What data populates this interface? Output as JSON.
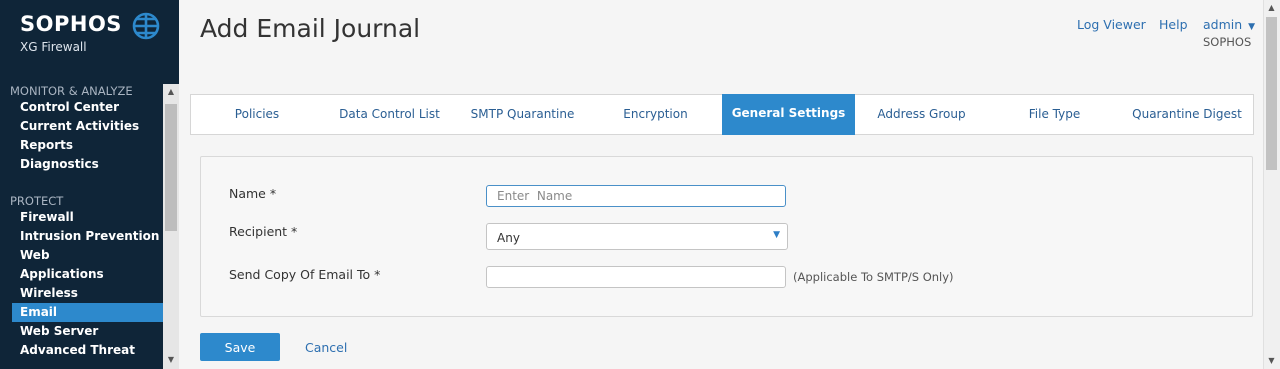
{
  "brand": {
    "name": "SOPHOS",
    "product": "XG Firewall"
  },
  "sidebar": {
    "sections": [
      {
        "title": "MONITOR & ANALYZE",
        "items": [
          "Control Center",
          "Current Activities",
          "Reports",
          "Diagnostics"
        ]
      },
      {
        "title": "PROTECT",
        "items": [
          "Firewall",
          "Intrusion Prevention",
          "Web",
          "Applications",
          "Wireless",
          "Email",
          "Web Server",
          "Advanced Threat"
        ]
      }
    ],
    "active_item": "Email"
  },
  "header": {
    "title": "Add Email Journal",
    "links": {
      "log_viewer": "Log Viewer",
      "help": "Help",
      "user": "admin"
    },
    "user_org": "SOPHOS"
  },
  "tabs": [
    "Policies",
    "Data Control List",
    "SMTP Quarantine",
    "Encryption",
    "General Settings",
    "Address Group",
    "File Type",
    "Quarantine Digest"
  ],
  "active_tab": "General Settings",
  "form": {
    "name": {
      "label": "Name *",
      "placeholder": "Enter  Name",
      "value": ""
    },
    "recipient": {
      "label": "Recipient *",
      "value": "Any"
    },
    "send_copy": {
      "label": "Send Copy Of Email To *",
      "value": "",
      "hint": "(Applicable To SMTP/S Only)"
    }
  },
  "actions": {
    "save": "Save",
    "cancel": "Cancel"
  },
  "colors": {
    "sidebar_bg": "#0f2538",
    "accent": "#2d89cc",
    "link": "#2d6fb0"
  },
  "icons": [
    "globe-logo-icon",
    "caret-down-icon",
    "scroll-up-icon",
    "scroll-down-icon"
  ]
}
